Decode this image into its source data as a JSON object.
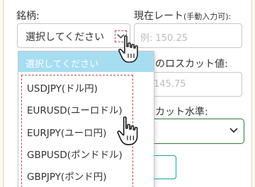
{
  "labels": {
    "symbol": "銘柄:",
    "current_rate": "現在レート",
    "current_rate_note": "(手動入力可):",
    "losscut_value": "のロスカット値:",
    "losscut_level": "カット水準:"
  },
  "symbol_select": {
    "selected": "選択してください"
  },
  "current_rate_input": {
    "placeholder": "例: 150.25"
  },
  "losscut_input": {
    "placeholder": "145.75"
  },
  "dropdown": {
    "header": "選択してください",
    "options": [
      "USDJPY(ドル円)",
      "EURUSD(ユーロドル)",
      "EURJPY(ユーロ円)",
      "GBPUSD(ポンドドル)",
      "GBPJPY(ポンド円)"
    ]
  },
  "colors": {
    "dropdown_header": "#a6ddf0",
    "dashed_highlight": "#b0524f",
    "green_border": "#2e7d32",
    "teal_border": "#1aa1a1"
  },
  "icons": [
    "pointer-hand-icon",
    "chevron-down-icon"
  ]
}
